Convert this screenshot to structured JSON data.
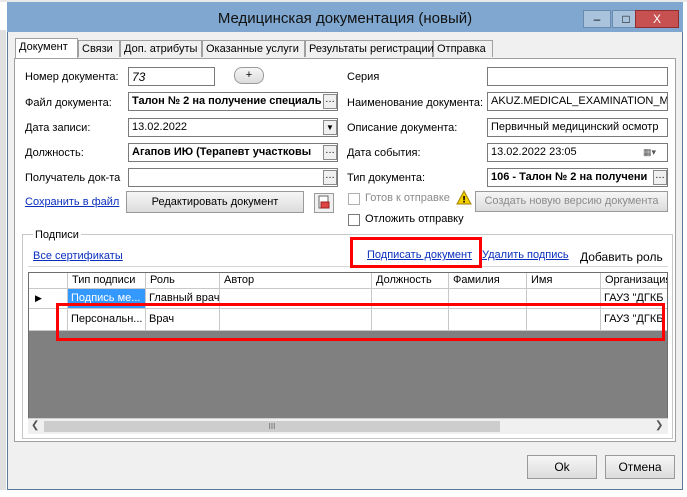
{
  "window": {
    "title": "Медицинская документация (новый)",
    "controls": {
      "minimize": "–",
      "maximize": "□",
      "close": "X"
    }
  },
  "tabs": [
    {
      "label": "Документ"
    },
    {
      "label": "Связи"
    },
    {
      "label": "Доп. атрибуты"
    },
    {
      "label": "Оказанные услуги"
    },
    {
      "label": "Результаты регистрации"
    },
    {
      "label": "Отправка"
    }
  ],
  "form": {
    "doc_number_label": "Номер документа:",
    "doc_number_value": "73",
    "add_button": "+",
    "file_label": "Файл документа:",
    "file_value": "Талон № 2 на получение специаль",
    "record_date_label": "Дата записи:",
    "record_date_value": "13.02.2022",
    "position_label": "Должность:",
    "position_value": "Агапов ИЮ (Терапевт участковы",
    "recipient_label": "Получатель док-та",
    "recipient_value": "",
    "save_link": "Сохранить в файл",
    "edit_button": "Редактировать документ",
    "series_label": "Серия",
    "series_value": "",
    "doc_name_label": "Наименование документа:",
    "doc_name_value": "AKUZ.MEDICAL_EXAMINATION_MAI",
    "doc_desc_label": "Описание документа:",
    "doc_desc_value": "Первичный медицинский осмотр",
    "event_date_label": "Дата события:",
    "event_date_value": "13.02.2022 23:05",
    "doc_type_label": "Тип документа:",
    "doc_type_value": "106 - Талон № 2 на получени",
    "ready_label": "Готов к отправке",
    "new_version_button": "Создать новую версию документа",
    "postpone_label": "Отложить отправку"
  },
  "signatures": {
    "group_label": "Подписи",
    "all_certs_link": "Все сертификаты",
    "sign_link": "Подписать документ",
    "delete_link": "Удалить подпись",
    "add_role": "Добавить роль",
    "columns": [
      "Тип подписи",
      "Роль",
      "Автор",
      "Должность",
      "Фамилия",
      "Имя",
      "Организация"
    ],
    "rows": [
      [
        "Подпись ме...",
        "Главный врач",
        "",
        "",
        "",
        "",
        "ГАУЗ \"ДГКБ"
      ],
      [
        "Персональн...",
        "Врач",
        "",
        "",
        "",
        "",
        "ГАУЗ \"ДГКБ"
      ]
    ],
    "scroll_mid": "III",
    "current_row_marker": "▶"
  },
  "footer": {
    "ok": "Ok",
    "cancel": "Отмена"
  },
  "colors": {
    "highlight": "#ff0000",
    "title_bar": "#7fa7cf",
    "selected_cell": "#3399ff"
  }
}
